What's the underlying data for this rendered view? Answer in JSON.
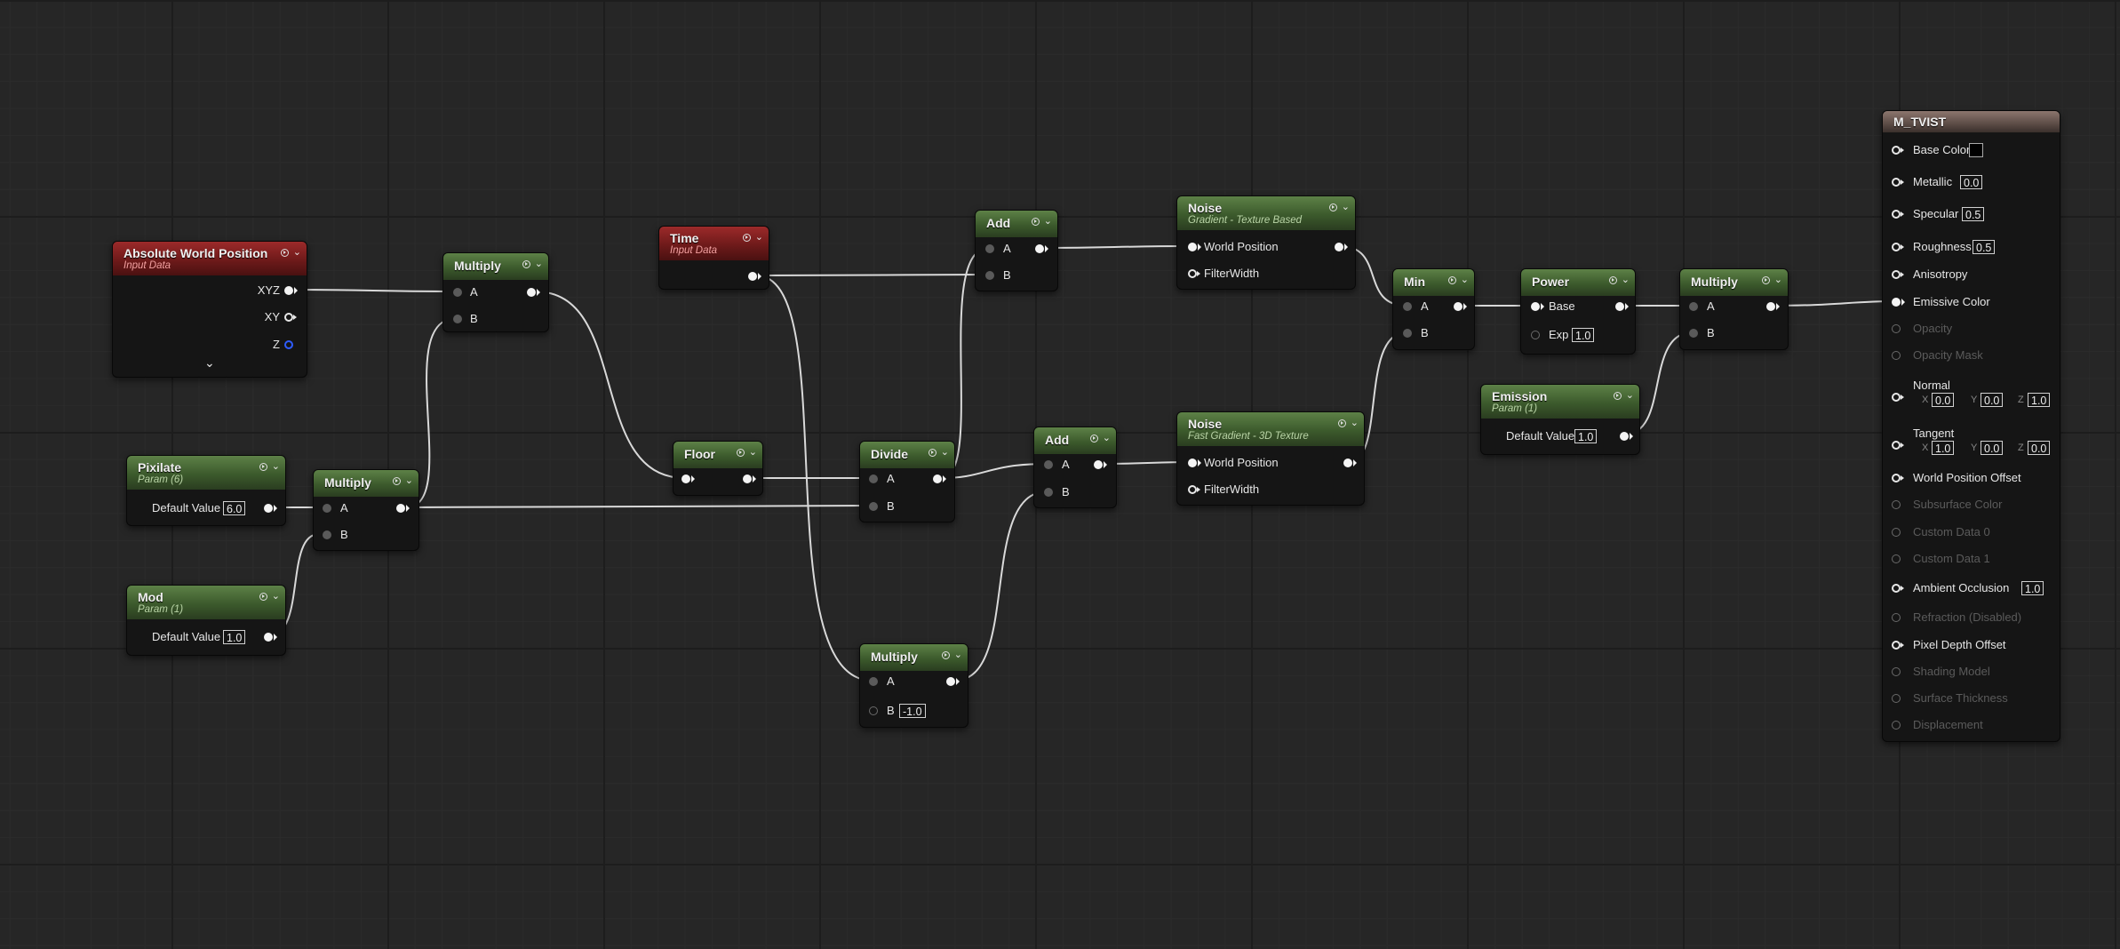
{
  "nodes": {
    "abs_world_pos": {
      "title": "Absolute World Position",
      "subtitle": "Input Data",
      "pins": {
        "xyz": "XYZ",
        "xy": "XY",
        "z": "Z"
      }
    },
    "pixilate": {
      "title": "Pixilate",
      "subtitle": "Param (6)",
      "label": "Default Value",
      "value": "6.0"
    },
    "mod": {
      "title": "Mod",
      "subtitle": "Param (1)",
      "label": "Default Value",
      "value": "1.0"
    },
    "multiply1": {
      "title": "Multiply",
      "a": "A",
      "b": "B"
    },
    "multiply2": {
      "title": "Multiply",
      "a": "A",
      "b": "B"
    },
    "time": {
      "title": "Time",
      "subtitle": "Input Data"
    },
    "floor": {
      "title": "Floor"
    },
    "divide": {
      "title": "Divide",
      "a": "A",
      "b": "B"
    },
    "add1": {
      "title": "Add",
      "a": "A",
      "b": "B"
    },
    "add2": {
      "title": "Add",
      "a": "A",
      "b": "B"
    },
    "multiply3": {
      "title": "Multiply",
      "a": "A",
      "b": "B",
      "b_value": "-1.0"
    },
    "noise1": {
      "title": "Noise",
      "subtitle": "Gradient - Texture Based",
      "world_position": "World Position",
      "filter_width": "FilterWidth"
    },
    "noise2": {
      "title": "Noise",
      "subtitle": "Fast Gradient - 3D Texture",
      "world_position": "World Position",
      "filter_width": "FilterWidth"
    },
    "min": {
      "title": "Min",
      "a": "A",
      "b": "B"
    },
    "power": {
      "title": "Power",
      "base": "Base",
      "exp": "Exp",
      "exp_value": "1.0"
    },
    "multiply4": {
      "title": "Multiply",
      "a": "A",
      "b": "B"
    },
    "emission": {
      "title": "Emission",
      "subtitle": "Param (1)",
      "label": "Default Value",
      "value": "1.0"
    }
  },
  "material": {
    "title": "M_TVIST",
    "base_color": "Base Color",
    "metallic": "Metallic",
    "metallic_value": "0.0",
    "specular": "Specular",
    "specular_value": "0.5",
    "roughness": "Roughness",
    "roughness_value": "0.5",
    "anisotropy": "Anisotropy",
    "emissive_color": "Emissive Color",
    "opacity": "Opacity",
    "opacity_mask": "Opacity Mask",
    "normal": "Normal",
    "normal_x": "0.0",
    "normal_y": "0.0",
    "normal_z": "1.0",
    "tangent": "Tangent",
    "tangent_x": "1.0",
    "tangent_y": "0.0",
    "tangent_z": "0.0",
    "axis_x": "X",
    "axis_y": "Y",
    "axis_z": "Z",
    "world_position_offset": "World Position Offset",
    "subsurface_color": "Subsurface Color",
    "custom_data_0": "Custom Data 0",
    "custom_data_1": "Custom Data 1",
    "ambient_occlusion": "Ambient Occlusion",
    "ambient_occlusion_value": "1.0",
    "refraction": "Refraction (Disabled)",
    "pixel_depth_offset": "Pixel Depth Offset",
    "shading_model": "Shading Model",
    "surface_thickness": "Surface Thickness",
    "displacement": "Displacement"
  },
  "colors": {
    "wire": "#d9d9d9",
    "grid_bg": "#262626",
    "param_header": "#4b6b38",
    "input_header": "#8a2222",
    "output_header": "#7a655d"
  }
}
